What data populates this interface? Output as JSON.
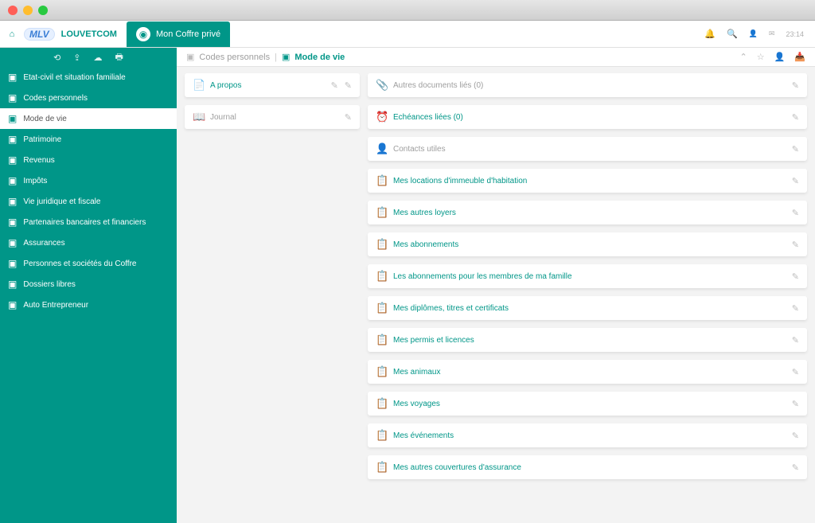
{
  "org_name": "LOUVETCOM",
  "logo_text": "MLV",
  "tab_title": "Mon Coffre privé",
  "header_time": "23:14",
  "breadcrumb": {
    "parent": "Codes personnels",
    "current": "Mode de vie"
  },
  "sidebar": {
    "items": [
      {
        "label": "Etat-civil et situation familiale",
        "active": false
      },
      {
        "label": "Codes personnels",
        "active": false
      },
      {
        "label": "Mode de vie",
        "active": true
      },
      {
        "label": "Patrimoine",
        "active": false
      },
      {
        "label": "Revenus",
        "active": false
      },
      {
        "label": "Impôts",
        "active": false
      },
      {
        "label": "Vie juridique et fiscale",
        "active": false
      },
      {
        "label": "Partenaires bancaires et financiers",
        "active": false
      },
      {
        "label": "Assurances",
        "active": false
      },
      {
        "label": "Personnes et sociétés du Coffre",
        "active": false
      },
      {
        "label": "Dossiers libres",
        "active": false
      },
      {
        "label": "Auto Entrepreneur",
        "active": false
      }
    ]
  },
  "left_cards": [
    {
      "icon": "📄",
      "title": "A propos",
      "muted": false,
      "actions": 2
    },
    {
      "icon": "📖",
      "title": "Journal",
      "muted": true,
      "actions": 1
    }
  ],
  "right_cards": [
    {
      "icon": "📎",
      "title": "Autres documents liés (0)",
      "muted": true
    },
    {
      "icon": "⏰",
      "title": "Echéances liées (0)",
      "muted": false
    },
    {
      "icon": "👤",
      "title": "Contacts utiles",
      "muted": true
    },
    {
      "icon": "📋",
      "title": "Mes locations d'immeuble d'habitation",
      "muted": false
    },
    {
      "icon": "📋",
      "title": "Mes autres loyers",
      "muted": false
    },
    {
      "icon": "📋",
      "title": "Mes abonnements",
      "muted": false
    },
    {
      "icon": "📋",
      "title": "Les abonnements pour les membres de ma famille",
      "muted": false
    },
    {
      "icon": "📋",
      "title": "Mes diplômes, titres et certificats",
      "muted": false
    },
    {
      "icon": "📋",
      "title": "Mes permis et licences",
      "muted": false
    },
    {
      "icon": "📋",
      "title": "Mes animaux",
      "muted": false
    },
    {
      "icon": "📋",
      "title": "Mes voyages",
      "muted": false
    },
    {
      "icon": "📋",
      "title": "Mes événements",
      "muted": false
    },
    {
      "icon": "📋",
      "title": "Mes autres couvertures d'assurance",
      "muted": false
    }
  ]
}
